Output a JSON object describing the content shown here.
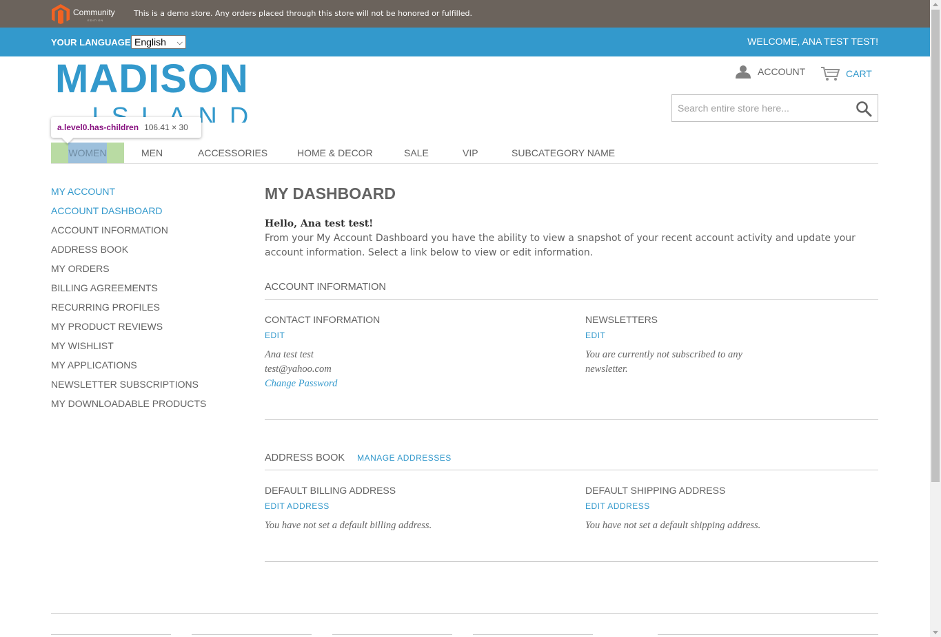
{
  "demo_bar": {
    "logo_text": "Community",
    "logo_subtext": "EDITION",
    "notice": "This is a demo store. Any orders placed through this store will not be honored or fulfilled."
  },
  "language_bar": {
    "label": "YOUR LANGUAGE:",
    "selected_language": "English",
    "welcome": "WELCOME, ANA TEST TEST!"
  },
  "header": {
    "brand_main": "MADISON",
    "brand_sub": "ISLAND",
    "account_label": "ACCOUNT",
    "cart_label": "CART",
    "search_placeholder": "Search entire store here..."
  },
  "devtools_tooltip": {
    "selector": "a.level0.has-children",
    "dimensions": "106.41 × 30"
  },
  "nav": {
    "items": [
      "WOMEN",
      "MEN",
      "ACCESSORIES",
      "HOME & DECOR",
      "SALE",
      "VIP",
      "SUBCATEGORY NAME"
    ]
  },
  "sidebar": {
    "title": "MY ACCOUNT",
    "items": [
      "ACCOUNT DASHBOARD",
      "ACCOUNT INFORMATION",
      "ADDRESS BOOK",
      "MY ORDERS",
      "BILLING AGREEMENTS",
      "RECURRING PROFILES",
      "MY PRODUCT REVIEWS",
      "MY WISHLIST",
      "MY APPLICATIONS",
      "NEWSLETTER SUBSCRIPTIONS",
      "MY DOWNLOADABLE PRODUCTS"
    ]
  },
  "main": {
    "title": "MY DASHBOARD",
    "hello": "Hello, Ana test test!",
    "intro": "From your My Account Dashboard you have the ability to view a snapshot of your recent account activity and update your account information. Select a link below to view or edit information.",
    "account_info": {
      "heading": "ACCOUNT INFORMATION",
      "contact_heading": "CONTACT INFORMATION",
      "contact_edit": "EDIT",
      "contact_name": "Ana test test",
      "contact_email": "test@yahoo.com",
      "change_password": "Change Password",
      "newsletters_heading": "NEWSLETTERS",
      "newsletters_edit": "EDIT",
      "newsletters_text": "You are currently not subscribed to any newsletter."
    },
    "address_book": {
      "heading": "ADDRESS BOOK",
      "manage_link": "MANAGE ADDRESSES",
      "billing_heading": "DEFAULT BILLING ADDRESS",
      "billing_edit": "EDIT ADDRESS",
      "billing_text": "You have not set a default billing address.",
      "shipping_heading": "DEFAULT SHIPPING ADDRESS",
      "shipping_edit": "EDIT ADDRESS",
      "shipping_text": "You have not set a default shipping address."
    }
  },
  "colors": {
    "demo_bar": "#6b635c",
    "accent": "#3399cc",
    "text": "#636363"
  },
  "icons": {
    "logo": "magento-logo-icon",
    "account": "user-icon",
    "cart": "cart-icon",
    "search": "search-icon"
  }
}
